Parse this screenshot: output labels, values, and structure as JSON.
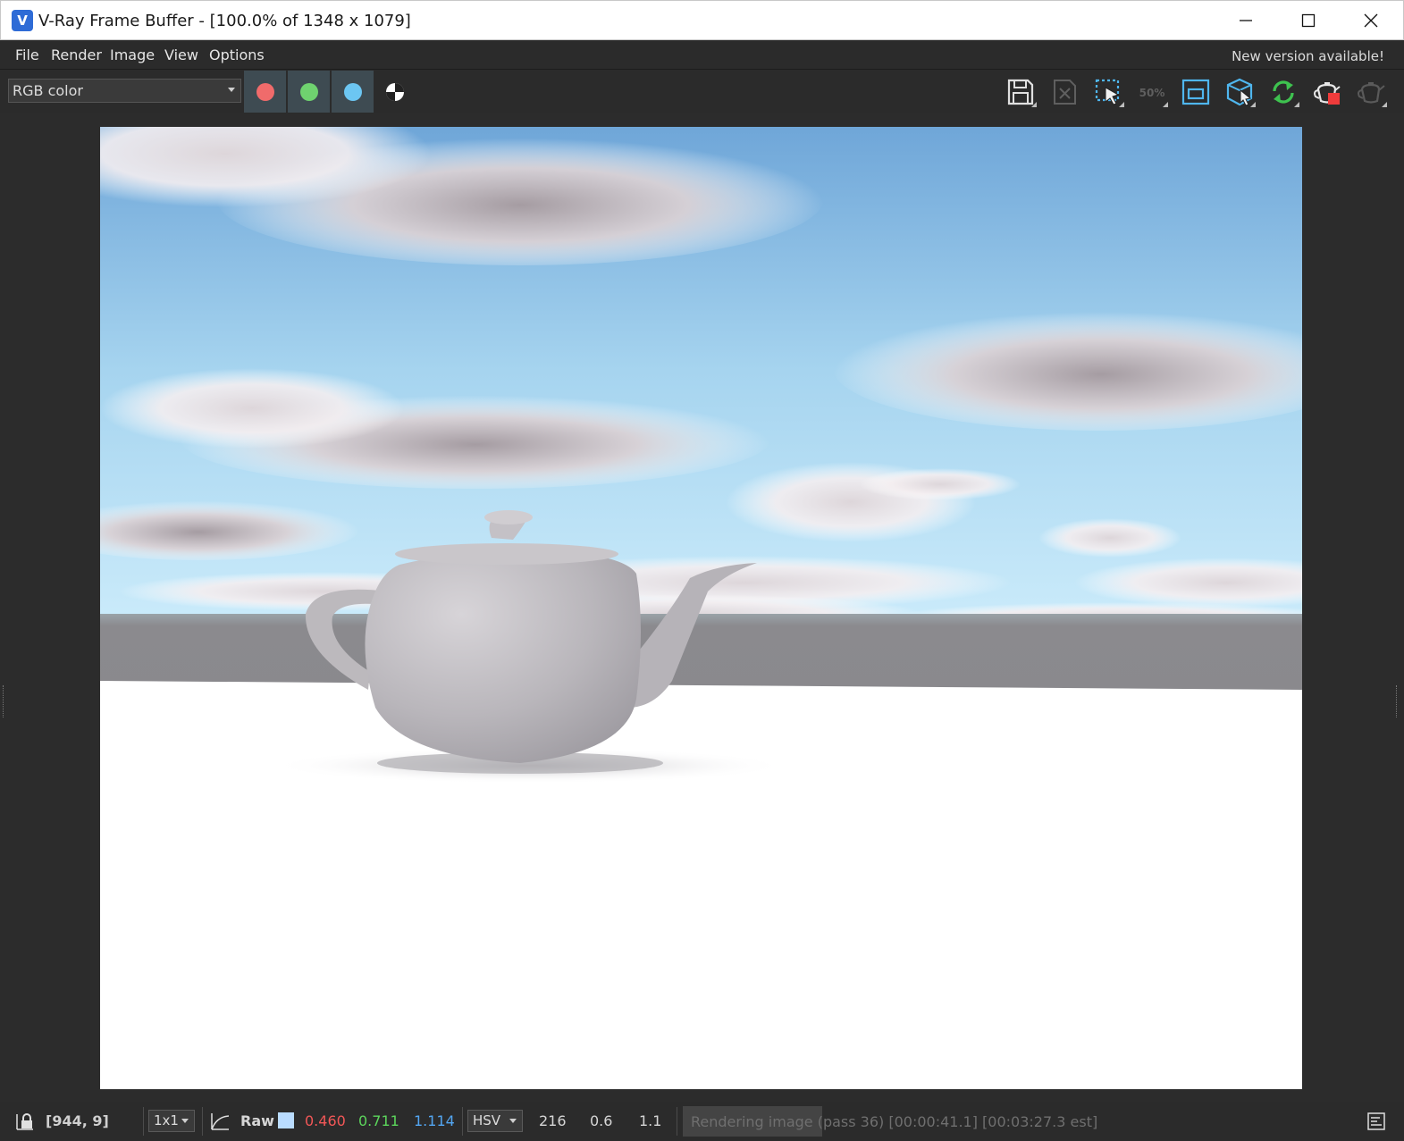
{
  "window": {
    "title": "V-Ray Frame Buffer - [100.0% of 1348 x 1079]",
    "app_icon_letter": "V"
  },
  "menu": {
    "items": [
      "File",
      "Render",
      "Image",
      "View",
      "Options"
    ],
    "notice": "New version available!"
  },
  "toolbar": {
    "channel": "RGB color",
    "channel_buttons": [
      {
        "name": "red-channel",
        "color": "#f06b6b"
      },
      {
        "name": "green-channel",
        "color": "#6fd26f"
      },
      {
        "name": "blue-channel",
        "color": "#6cc6f2"
      }
    ],
    "icons": [
      "save-image-icon",
      "clear-image-icon",
      "region-render-icon",
      "zoom-50-icon",
      "render-region-frame-icon",
      "track-mouse-icon",
      "update-render-icon",
      "stop-render-icon",
      "render-icon"
    ],
    "zoom_label": "50%"
  },
  "status": {
    "coords": "[944, 9]",
    "sample_size": "1x1",
    "mode": "Raw",
    "swatch_color": "#b9dcff",
    "r": "0.460",
    "g": "0.711",
    "b": "1.114",
    "color_space": "HSV",
    "h": "216",
    "s": "0.6",
    "v": "1.1",
    "progress_text": "Rendering image (pass 36) [00:00:41.1] [00:03:27.3 est]",
    "progress_fraction": 0.2
  }
}
